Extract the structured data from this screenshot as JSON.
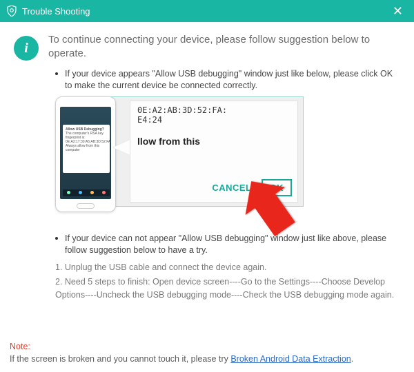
{
  "titlebar": {
    "title": "Trouble Shooting"
  },
  "intro": "To continue connecting your device, please follow suggestion below to operate.",
  "bullet1": "If your device appears \"Allow USB debugging\" window just like below, please click OK to make the current device  be connected correctly.",
  "bullet2": "If your device can not appear \"Allow USB debugging\" window just like above, please follow suggestion below to have a try.",
  "zoom": {
    "mac1": "0E:A2:AB:3D:52:FA:",
    "mac2": "E4:24",
    "from": "llow from this",
    "cancel": "CANCEL",
    "ok": "OK"
  },
  "phone_dialog_title": "Allow USB Debugging?",
  "phone_dialog_body": "The computer's RSA key fingerprint is:\n0E:A2:17:30:A5:AB:3D:52:FA\nAlways allow from this computer",
  "step1": "1. Unplug the USB cable and connect the device again.",
  "step2": "2. Need 5 steps to finish: Open device screen----Go to the Settings----Choose Develop Options----Uncheck the USB debugging mode----Check the USB debugging mode again.",
  "footer": {
    "note": "Note:",
    "text": "If the screen is broken and you cannot touch it, please try ",
    "link": "Broken Android Data Extraction",
    "after": "."
  }
}
